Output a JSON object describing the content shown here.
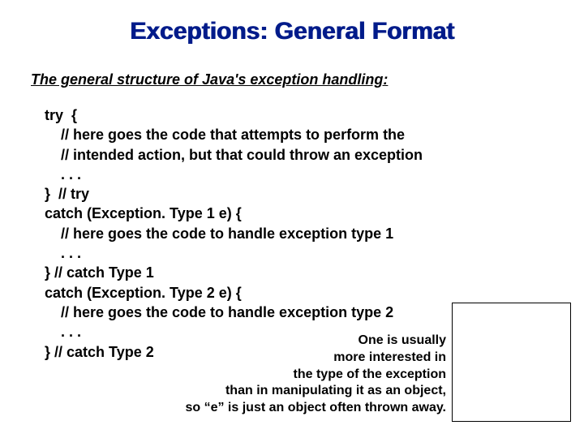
{
  "title": "Exceptions: General Format",
  "subtitle": "The  general  structure of Java's exception handling:",
  "code": "try  {\n    // here goes the code that attempts to perform the\n    // intended action, but that could throw an exception\n    . . .\n}  // try\ncatch (Exception. Type 1 e) {\n    // here goes the code to handle exception type 1\n    . . .\n} // catch Type 1\ncatch (Exception. Type 2 e) {\n    // here goes the code to handle exception type 2\n    . . .\n} // catch Type 2",
  "note": "One is usually\nmore interested in\nthe type of the exception\nthan in manipulating it as an object,\nso “e” is just an object often thrown away."
}
